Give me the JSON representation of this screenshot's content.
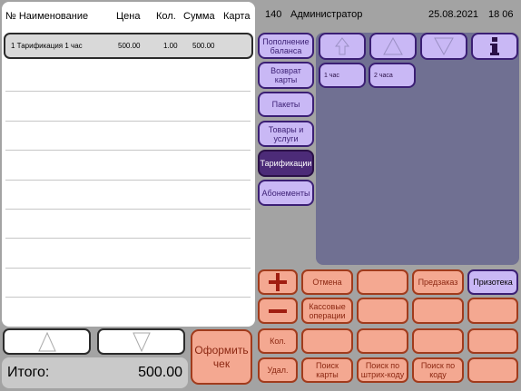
{
  "receipt": {
    "headers": {
      "no_name": "№ Наименование",
      "price": "Цена",
      "qty": "Кол.",
      "sum": "Сумма",
      "card": "Карта"
    },
    "rows": [
      {
        "name": "1 Тарификация 1 час",
        "price": "500.00",
        "qty": "1.00",
        "sum": "500.00"
      }
    ],
    "total_label": "Итого:",
    "total_value": "500.00",
    "checkout_label": "Оформить\nчек"
  },
  "topbar": {
    "number": "140",
    "user": "Администратор",
    "date": "25.08.2021",
    "time": "18 06"
  },
  "categories": [
    "Пополнение\nбаланса",
    "Возврат\nкарты",
    "Пакеты",
    "Товары и\nуслуги",
    "Тарификации",
    "Абонементы"
  ],
  "active_category": "Тарификации",
  "products": [
    "1 час",
    "2 часа"
  ],
  "actions": {
    "cancel": "Отмена",
    "preorder": "Предзаказ",
    "prizotека": "Призотека",
    "cash_ops": "Кассовые\nоперации",
    "qty": "Кол.",
    "delete": "Удал.",
    "search_card": "Поиск\nкарты",
    "search_barcode": "Поиск по\nштрих-коду",
    "search_code": "Поиск по\nкоду"
  },
  "icons": {
    "plus": "plus-icon",
    "minus": "minus-icon",
    "info": "info-icon",
    "up": "arrow-up-icon",
    "down": "arrow-down-icon"
  },
  "colors": {
    "salmon": "#f4a891",
    "salmon_border": "#a13b1c",
    "lavender": "#c9b8f5",
    "purple_dark": "#4c2b78",
    "panel_slate": "#707092"
  }
}
